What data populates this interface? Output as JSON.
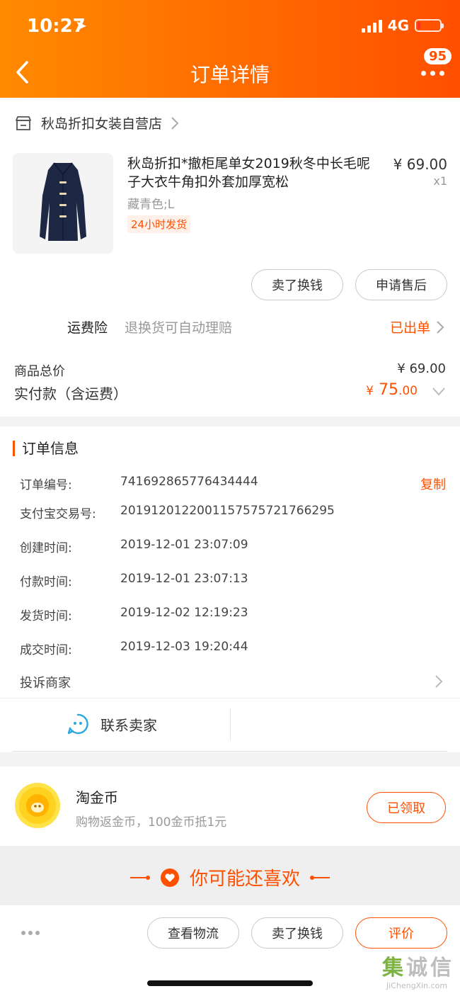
{
  "status_bar": {
    "time": "10:27",
    "network": "4G"
  },
  "header": {
    "title": "订单详情",
    "badge_count": "95"
  },
  "shop": {
    "name": "秋岛折扣女装自营店"
  },
  "product": {
    "title": "秋岛折扣*撤柜尾单女2019秋冬中长毛呢子大衣牛角扣外套加厚宽松",
    "price": "¥ 69.00",
    "qty": "x1",
    "sku": "藏青色;L",
    "tag": "24小时发货"
  },
  "item_actions": {
    "sell_label": "卖了换钱",
    "after_sale_label": "申请售后"
  },
  "insurance": {
    "label": "运费险",
    "desc": "退换货可自动理赔",
    "status": "已出单"
  },
  "totals": {
    "goods_label": "商品总价",
    "goods_value": "¥ 69.00",
    "paid_label": "实付款（含运费）",
    "paid_symbol": "¥",
    "paid_int": "75",
    "paid_dec": ".00"
  },
  "order_info": {
    "title": "订单信息",
    "copy_label": "复制",
    "rows": [
      {
        "label": "订单编号:",
        "value": "741692865776434444"
      },
      {
        "label": "支付宝交易号:",
        "value": "2019120122001157575721766295"
      },
      {
        "label": "创建时间:",
        "value": "2019-12-01 23:07:09"
      },
      {
        "label": "付款时间:",
        "value": "2019-12-01 23:07:13"
      },
      {
        "label": "发货时间:",
        "value": "2019-12-02 12:19:23"
      },
      {
        "label": "成交时间:",
        "value": "2019-12-03 19:20:44"
      }
    ],
    "complain_label": "投诉商家",
    "contact_label": "联系卖家"
  },
  "coins": {
    "title": "淘金币",
    "desc": "购物返金币，100金币抵1元",
    "button": "已领取"
  },
  "recommend": {
    "title": "你可能还喜欢"
  },
  "bottom_bar": {
    "logistics": "查看物流",
    "sell": "卖了换钱",
    "review": "评价"
  },
  "watermark": {
    "chars": [
      "集",
      "诚",
      "信"
    ],
    "url": "JiChengXin.com"
  },
  "colors": {
    "accent": "#ff5000",
    "header_start": "#ff8a00",
    "header_end": "#ff4f00"
  }
}
